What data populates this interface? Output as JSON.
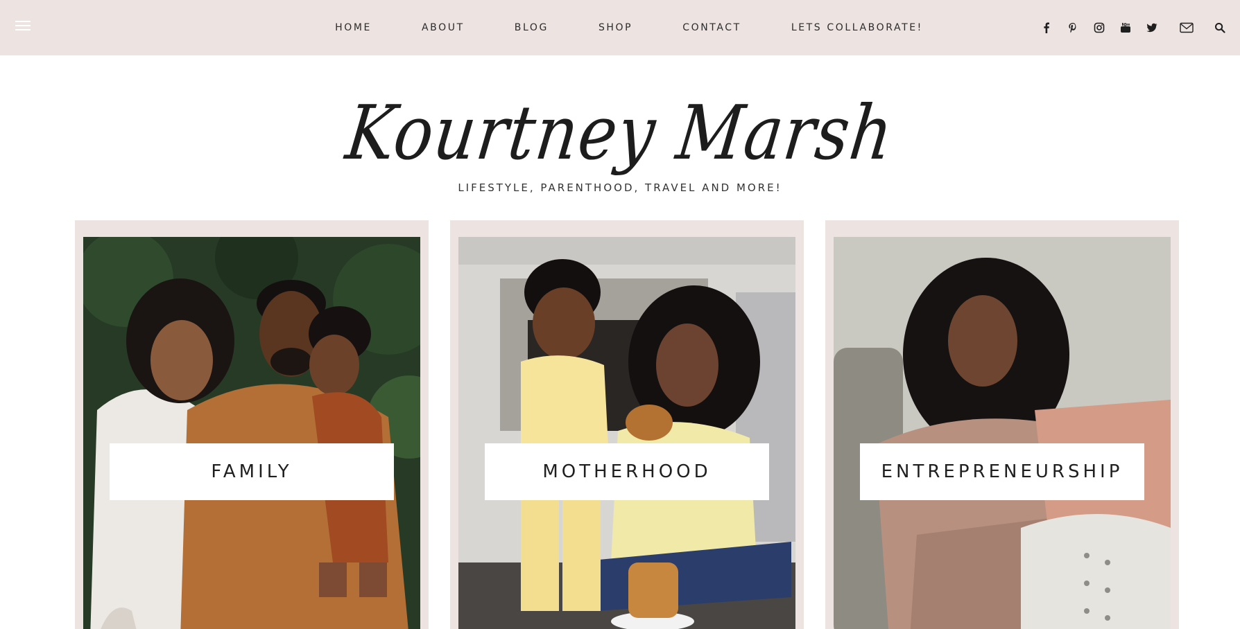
{
  "nav": {
    "menu_icon": "hamburger-icon",
    "items": [
      {
        "label": "HOME"
      },
      {
        "label": "ABOUT"
      },
      {
        "label": "BLOG"
      },
      {
        "label": "SHOP"
      },
      {
        "label": "CONTACT"
      },
      {
        "label": "LETS COLLABORATE!"
      }
    ],
    "social_icons": [
      "facebook-icon",
      "pinterest-icon",
      "instagram-icon",
      "youtube-icon",
      "twitter-icon",
      "mail-icon",
      "search-icon"
    ]
  },
  "header": {
    "logo_text": "Kourtney Marsh",
    "tagline": "LIFESTYLE, PARENTHOOD, TRAVEL AND MORE!"
  },
  "categories": [
    {
      "label": "FAMILY"
    },
    {
      "label": "MOTHERHOOD"
    },
    {
      "label": "ENTREPRENEURSHIP"
    }
  ],
  "colors": {
    "topbar_bg": "#ede3e1",
    "card_bg": "#ede3e1",
    "text": "#222222"
  }
}
